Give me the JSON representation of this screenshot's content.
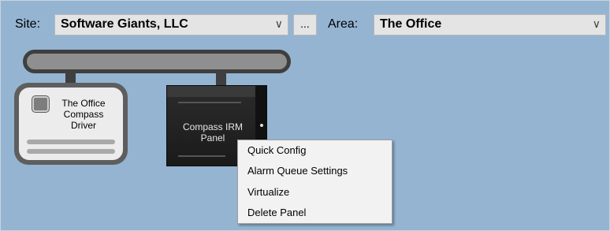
{
  "toolbar": {
    "site_label": "Site:",
    "site_value": "Software Giants, LLC",
    "browse_label": "...",
    "area_label": "Area:",
    "area_value": "The Office",
    "dropdown_arrow": "∨"
  },
  "diagram": {
    "driver": {
      "label_lines": [
        "The Office",
        "Compass",
        "Driver"
      ]
    },
    "panel": {
      "label_lines": [
        "Compass IRM",
        "Panel"
      ]
    }
  },
  "context_menu": {
    "items": [
      {
        "label": "Quick Config"
      },
      {
        "label": "Alarm Queue Settings"
      },
      {
        "label": "Virtualize"
      },
      {
        "label": "Delete Panel"
      }
    ]
  },
  "colors": {
    "canvas_background": "#94b4d2",
    "bus_border": "#3f3f3f",
    "status_led": "#e06666"
  },
  "icons": [
    "chevron-down-icon",
    "status-led-icon"
  ]
}
